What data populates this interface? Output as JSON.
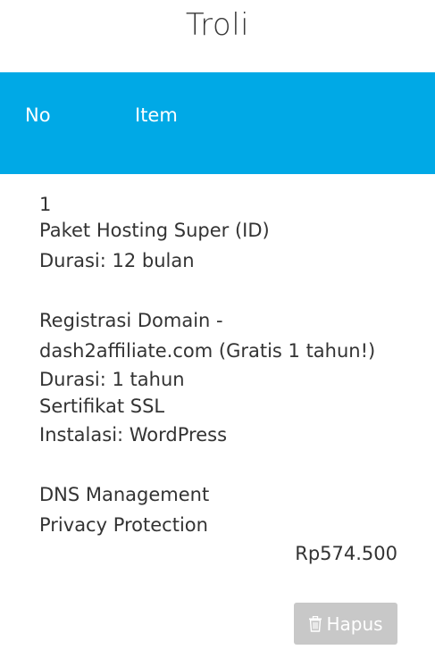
{
  "page": {
    "title": "Troli"
  },
  "table": {
    "header": {
      "no": "No",
      "item": "Item"
    },
    "rows": [
      {
        "no": "1",
        "lines": [
          "Paket Hosting Super (ID)",
          "Durasi: 12 bulan",
          "Registrasi Domain -",
          "dash2affiliate.com (Gratis 1 tahun!)",
          "Durasi: 1 tahun",
          "Sertifikat SSL",
          "Instalasi: WordPress",
          "DNS Management",
          "Privacy Protection"
        ],
        "price": "Rp574.500",
        "remove_label": "Hapus"
      }
    ]
  },
  "icons": {
    "remove": "trash-icon"
  },
  "colors": {
    "header_bg": "#00a9e6",
    "button_bg": "#c8c8c8"
  }
}
